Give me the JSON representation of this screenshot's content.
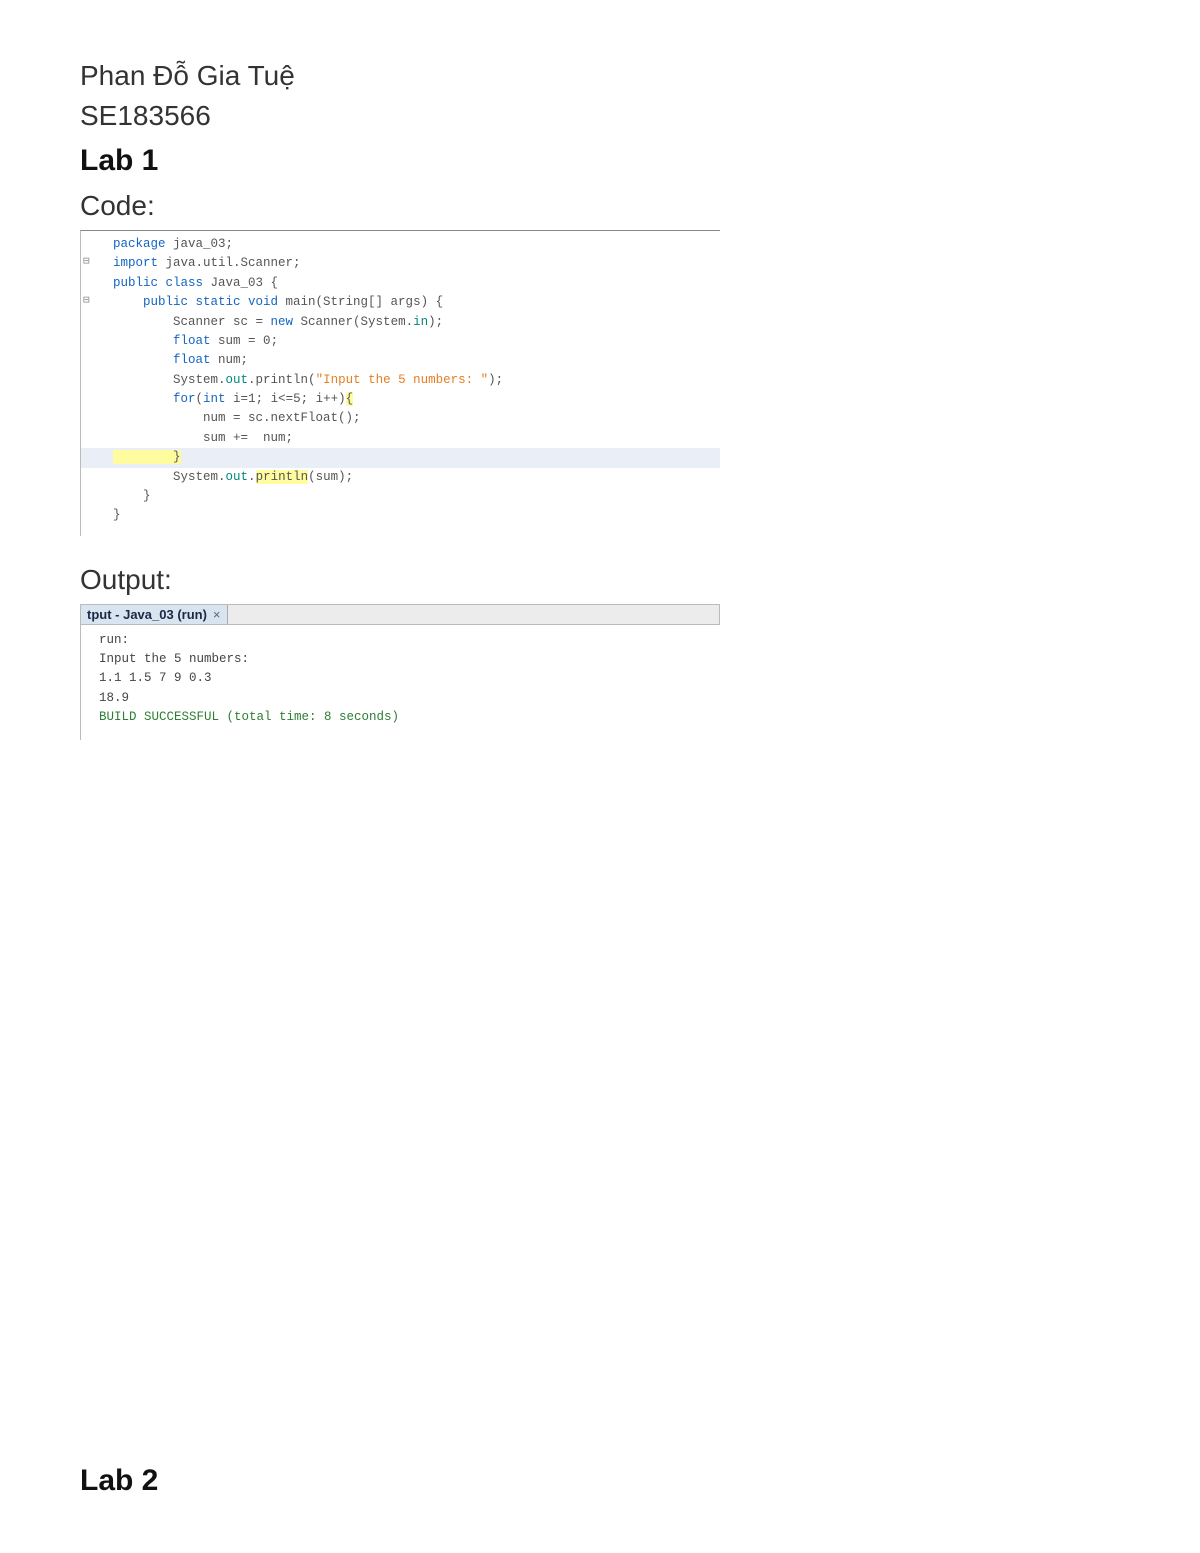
{
  "header": {
    "student_name": "Phan Đỗ Gia Tuệ",
    "student_id": "SE183566",
    "lab1_title": "Lab 1",
    "code_label": "Code:",
    "output_label": "Output:",
    "lab2_title": "Lab 2"
  },
  "code": {
    "l1_package": "package",
    "l1_rest": " java_03;",
    "l2_import": "import",
    "l2_rest": " java.util.Scanner;",
    "l3_a": "public class",
    "l3_b": " Java_03 {",
    "l4_a": "    public static void",
    "l4_b": " main",
    "l4_c": "(String[] args) {",
    "l5": "        Scanner sc = ",
    "l5_new": "new",
    "l5_b": " Scanner(System.",
    "l5_in": "in",
    "l5_c": ");",
    "l6_a": "        float",
    "l6_b": " sum = ",
    "l6_c": "0",
    "l6_d": ";",
    "l7_a": "        float",
    "l7_b": " num;",
    "l8_a": "        System.",
    "l8_out": "out",
    "l8_b": ".println(",
    "l8_str": "\"Input the 5 numbers: \"",
    "l8_c": ");",
    "l9_a": "        for",
    "l9_b": "(",
    "l9_int": "int",
    "l9_c": " i=",
    "l9_n1": "1",
    "l9_d": "; i<=",
    "l9_n5": "5",
    "l9_e": "; i++)",
    "l9_brace": "{",
    "l10": "            num = sc.nextFloat();",
    "l11": "            sum +=  num;",
    "l12_brace": "        }",
    "l13_a": "        System.",
    "l13_out": "out",
    "l13_b": ".",
    "l13_println": "println",
    "l13_c": "(sum);",
    "l14": "    }",
    "l15": "}"
  },
  "output_tab": {
    "label": "tput - Java_03 (run)",
    "close": "×"
  },
  "console": {
    "l1": "run:",
    "l2": "Input the 5 numbers: ",
    "l3": "1.1 1.5 7 9 0.3",
    "l4": "18.9",
    "l5": "BUILD SUCCESSFUL (total time: 8 seconds)"
  }
}
